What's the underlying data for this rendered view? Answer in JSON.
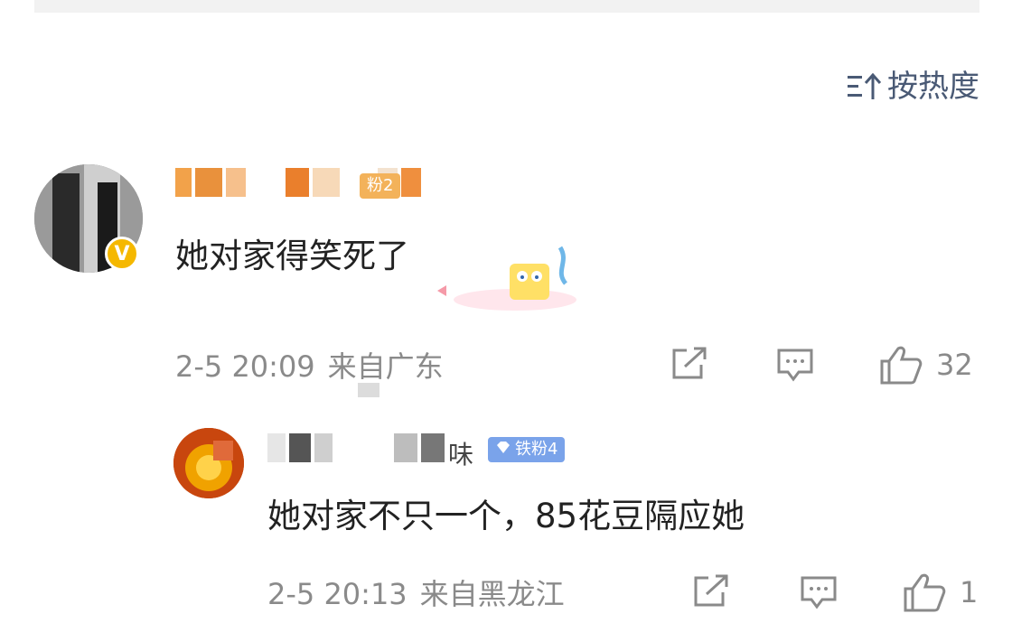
{
  "sort": {
    "label": "按热度",
    "icon": "sort-icon"
  },
  "comments": [
    {
      "text": "她对家得笑死了",
      "badge": "粉2",
      "verified_badge": "V",
      "time": "2-5 20:09",
      "location": "来自广东",
      "likes": "32",
      "reply": {
        "username_fragment": "味",
        "badge": "铁粉4",
        "text": "她对家不只一个，85花豆隔应她",
        "time": "2-5 20:13",
        "location": "来自黑龙江",
        "likes": "1"
      }
    }
  ],
  "colors": {
    "meta": "#8a8a8a",
    "fan_badge": "#f3b25a",
    "iron_badge": "#7aa3ea",
    "accent_sort": "#4a5a75"
  }
}
